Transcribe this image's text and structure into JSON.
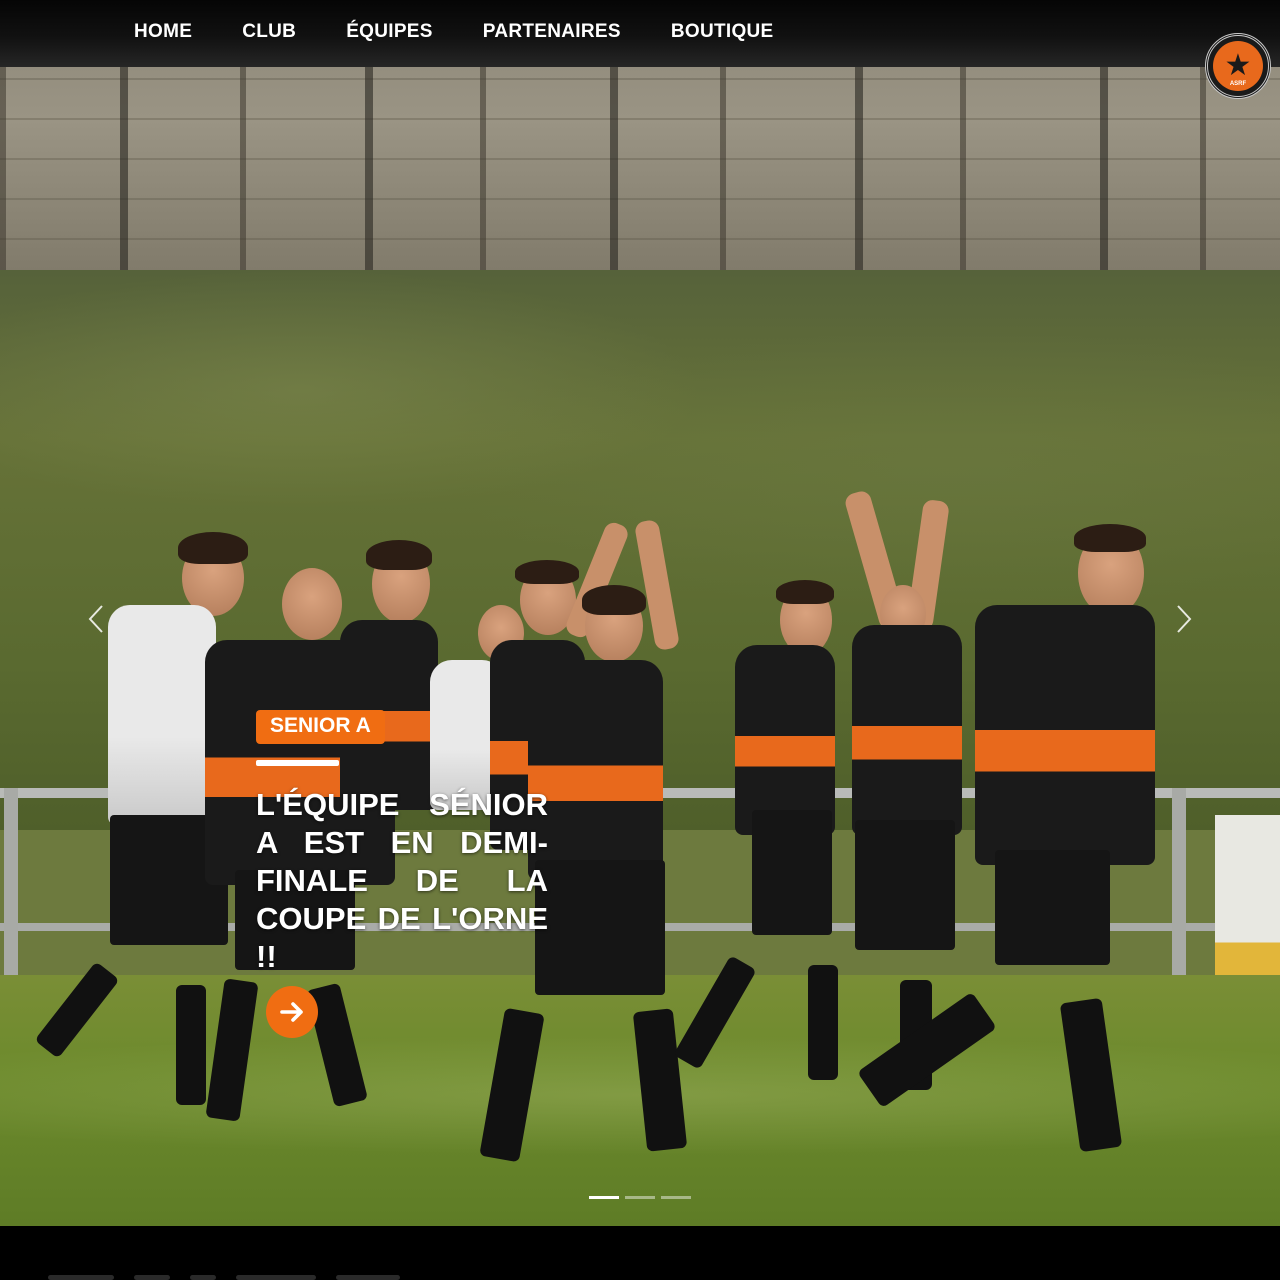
{
  "nav": {
    "items": [
      {
        "label": "HOME"
      },
      {
        "label": "CLUB"
      },
      {
        "label": "ÉQUIPES"
      },
      {
        "label": "PARTENAIRES"
      },
      {
        "label": "BOUTIQUE"
      }
    ]
  },
  "logo": {
    "icon": "club-crest-star",
    "text": "ASRF"
  },
  "slide": {
    "tag": "SENIOR A",
    "headline": "L'ÉQUIPE SÉNIOR A EST EN DEMI-FINALE DE LA COUPE DE L'ORNE !!",
    "button_icon": "arrow-right-icon"
  },
  "carousel": {
    "prev_icon": "chevron-left-icon",
    "next_icon": "chevron-right-icon",
    "slide_count": 3,
    "active_index": 0
  },
  "colors": {
    "accent": "#f06d12",
    "nav_bg": "#111111",
    "text": "#ffffff"
  }
}
